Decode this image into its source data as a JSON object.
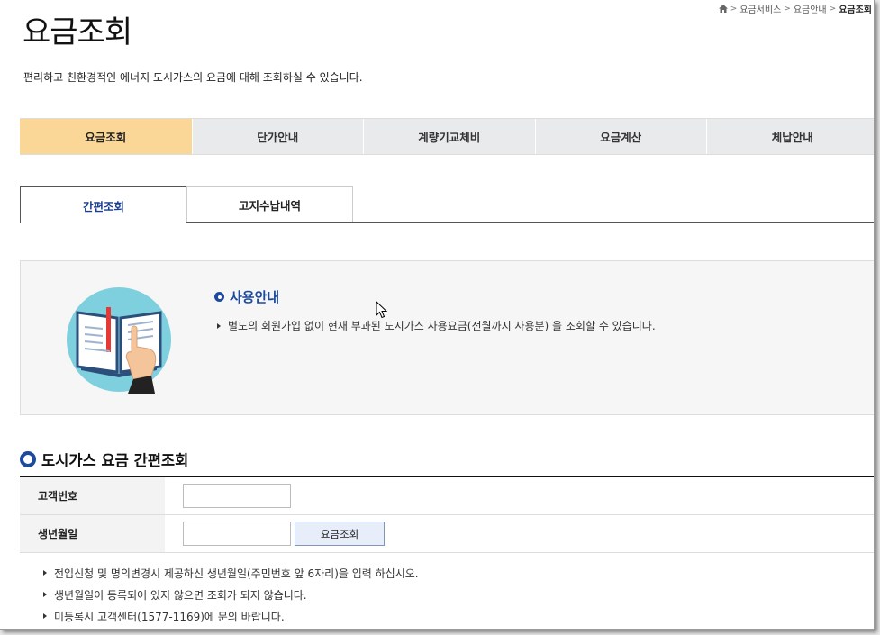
{
  "breadcrumb": {
    "items": [
      "요금서비스",
      "요금안내",
      "요금조회"
    ]
  },
  "page": {
    "title": "요금조회",
    "intro": "편리하고 친환경적인 에너지 도시가스의 요금에 대해 조회하실 수 있습니다."
  },
  "main_tabs": [
    {
      "label": "요금조회",
      "active": true
    },
    {
      "label": "단가안내",
      "active": false
    },
    {
      "label": "계량기교체비",
      "active": false
    },
    {
      "label": "요금계산",
      "active": false
    },
    {
      "label": "체납안내",
      "active": false
    }
  ],
  "sub_tabs": [
    {
      "label": "간편조회",
      "active": true
    },
    {
      "label": "고지수납내역",
      "active": false
    }
  ],
  "info": {
    "title": "사용안내",
    "line": "별도의 회원가입 없이 현재 부과된 도시가스 사용요금(전월까지 사용분) 을 조회할 수 있습니다."
  },
  "form": {
    "section_title": "도시가스 요금 간편조회",
    "customer_no_label": "고객번호",
    "customer_no_value": "",
    "birth_label": "생년월일",
    "birth_value": "",
    "search_button": "요금조회"
  },
  "notes": [
    "전입신청 및 명의변경시 제공하신 생년월일(주민번호 앞 6자리)을 입력 하십시오.",
    "생년월일이 등록되어 있지 않으면 조회가 되지 않습니다.",
    "미등록시 고객센터(1577-1169)에 문의 바랍니다."
  ],
  "colors": {
    "active_tab": "#fbd797",
    "inactive_tab": "#e9eaec",
    "accent_blue": "#1d4a9c"
  }
}
